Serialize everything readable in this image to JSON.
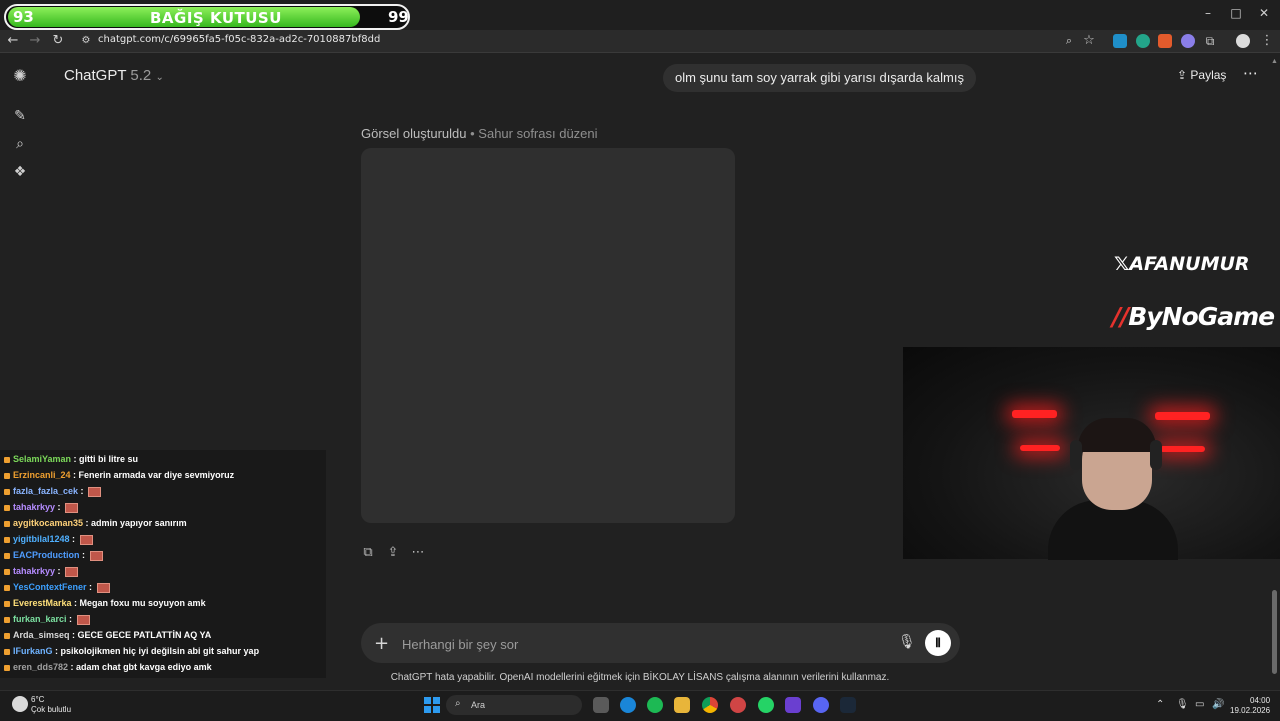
{
  "donation": {
    "left_value": "93",
    "title": "BAĞIŞ KUTUSU",
    "right_value": "99",
    "progress_percent": 93
  },
  "browser": {
    "url": "chatgpt.com/c/69965fa5-f05c-832a-ad2c-7010887bf8dd",
    "window_controls": {
      "minimize": "–",
      "maximize": "□",
      "close": "✕"
    }
  },
  "chatgpt": {
    "model_name": "ChatGPT",
    "model_version": "5.2",
    "share_label": "Paylaş",
    "user_message": "olm şunu tam soy yarrak gibi yarısı dışarda kalmış",
    "image_status": "Görsel oluşturuldu",
    "image_title": "• Sahur sofrası düzeni",
    "input_placeholder": "Herhangi bir şey sor",
    "disclaimer": "ChatGPT hata yapabilir. OpenAI modellerini eğitmek için BİKOLAY LİSANS çalışma alanının verilerini kullanmaz."
  },
  "overlay": {
    "x_handle": "AFANUMUR",
    "sponsor": "ByNoGame"
  },
  "chat": [
    {
      "user": "SelamiYaman",
      "color": "#7cd95a",
      "message": "gitti bi litre su",
      "emote": false
    },
    {
      "user": "Erzincanli_24",
      "color": "#f0a030",
      "message": "Fenerin armada var diye sevmiyoruz",
      "emote": false
    },
    {
      "user": "fazla_fazla_cek",
      "color": "#8ab4ff",
      "message": "",
      "emote": true
    },
    {
      "user": "tahakrkyy",
      "color": "#b58cff",
      "message": "",
      "emote": true
    },
    {
      "user": "aygitkocaman35",
      "color": "#ffd27a",
      "message": "admin yapıyor sanırım",
      "emote": false
    },
    {
      "user": "yigitbilal1248",
      "color": "#4fb0ff",
      "message": "",
      "emote": true
    },
    {
      "user": "EACProduction",
      "color": "#4f9dff",
      "message": "",
      "emote": true
    },
    {
      "user": "tahakrkyy",
      "color": "#b58cff",
      "message": "",
      "emote": true
    },
    {
      "user": "YesContextFener",
      "color": "#3da0ff",
      "message": "",
      "emote": true
    },
    {
      "user": "EverestMarka",
      "color": "#ffe07a",
      "message": "Megan foxu mu soyuyon amk",
      "emote": false
    },
    {
      "user": "furkan_karci",
      "color": "#7be0a0",
      "message": "",
      "emote": true
    },
    {
      "user": "Arda_simseq",
      "color": "#d9d9d9",
      "message": "GECE GECE PATLATTİN AQ YA",
      "emote": false
    },
    {
      "user": "IFurkanG",
      "color": "#6fb3ff",
      "message": "psikolojikmen hiç iyi değilsin abi git sahur yap",
      "emote": false
    },
    {
      "user": "eren_dds782",
      "color": "#a0a0a0",
      "message": "adam chat gbt kavga ediyo amk",
      "emote": false
    }
  ],
  "taskbar": {
    "weather_temp": "6°C",
    "weather_desc": "Çok bulutlu",
    "search_label": "Ara",
    "time": "04:00",
    "date": "19.02.2026"
  }
}
